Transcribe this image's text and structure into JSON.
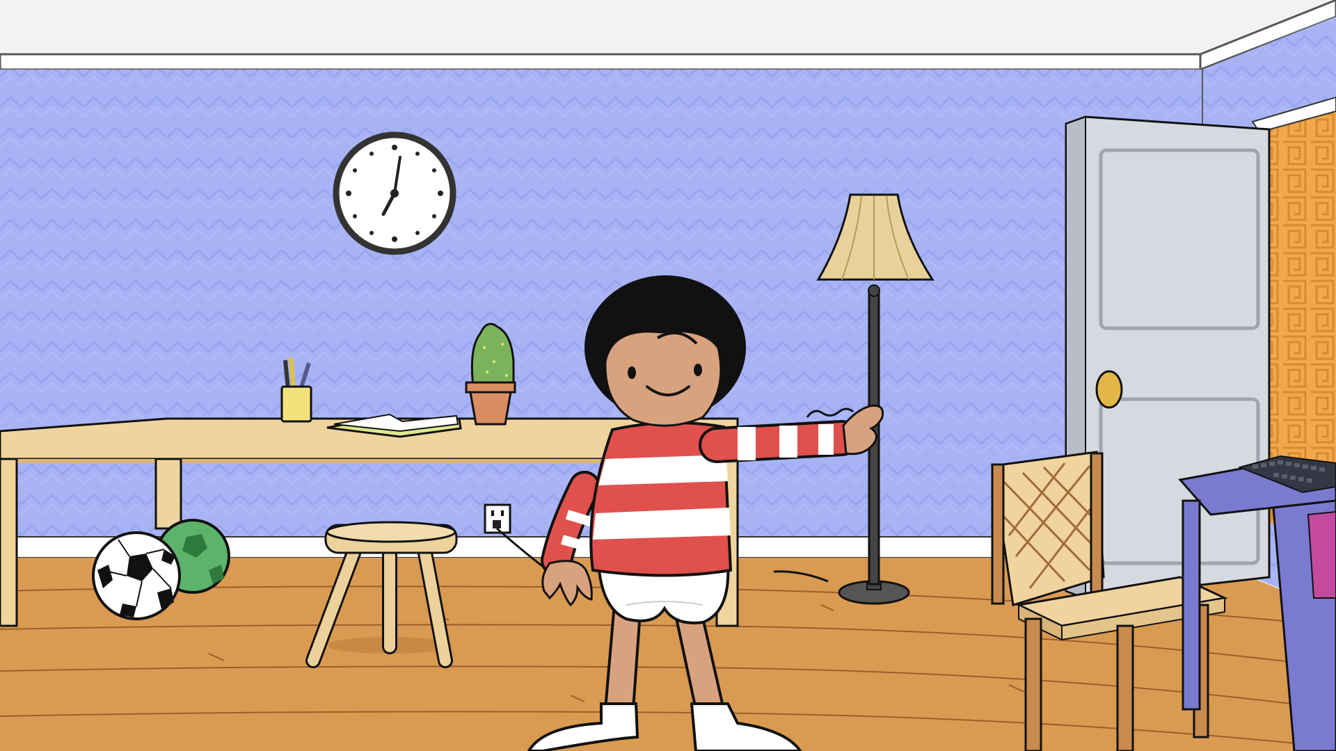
{
  "scene": {
    "colors": {
      "ceiling": "#f2f2f2",
      "crown_molding": "#ffffff",
      "outline": "#111111",
      "wall": "#a7b3f5",
      "wall_pattern": "#9aa8f0",
      "baseboard": "#ffffff",
      "floor": "#d99a52",
      "floor_lines": "#9a5f2a",
      "desk": "#efd49e",
      "stool": "#ecd29a",
      "clock_face": "#ffffff",
      "clock_rim": "#333333",
      "cactus": "#7bb35c",
      "pot": "#d98d62",
      "pencil_cup": "#f3e27a",
      "soccer_ball": "#ffffff",
      "green_ball": "#5cb36a",
      "lamp_shade": "#e8d29a",
      "lamp_pole": "#444444",
      "door": "#d6d9e0",
      "door_knob": "#e3b64a",
      "hallway_wallpaper": "#f0a84a",
      "chair_frame": "#c98a4e",
      "chair_seat": "#f0d39e",
      "side_table": "#7a7ad0",
      "keyboard": "#333844",
      "outlet": "#ffffff",
      "kid_skin": "#d9a27e",
      "kid_hair": "#111111",
      "shirt_red": "#e0504c",
      "shirt_white": "#ffffff",
      "diaper": "#ffffff",
      "socks": "#ffffff"
    },
    "clock": {
      "hour_hand": "7",
      "minute_hand": "1"
    },
    "objects": [
      "wall-clock",
      "desk",
      "pencil-cup",
      "open-book",
      "cactus-pot",
      "stool",
      "soccer-ball",
      "green-ball",
      "wall-outlet",
      "floor-lamp",
      "door",
      "chair",
      "side-table",
      "keyboard",
      "kid-character"
    ]
  }
}
